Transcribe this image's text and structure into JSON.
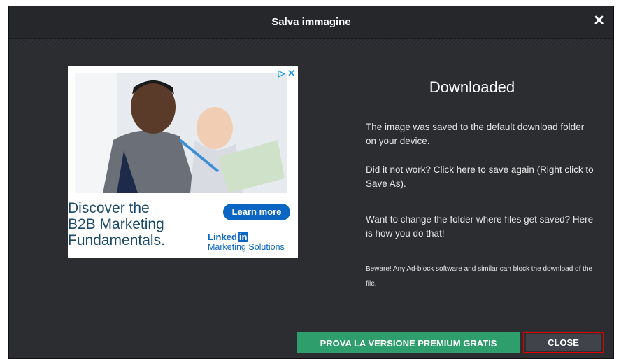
{
  "dialog": {
    "title": "Salva immagine",
    "close_icon": "close-icon",
    "heading": "Downloaded",
    "paragraphs": [
      "The image was saved to the default download folder on your device.",
      "Did it not work? Click here to save again (Right click to Save As).",
      "Want to change the folder where files get saved? Here is how you do that!",
      "Beware! Any Ad-block software and similar can block the download of the file."
    ],
    "premium_button": "PROVA LA VERSIONE PREMIUM GRATIS",
    "close_button": "CLOSE"
  },
  "ad": {
    "badge": "▷ ✕",
    "headline_lines": [
      "Discover the",
      "B2B Marketing",
      "Fundamentals."
    ],
    "cta": "Learn more",
    "brand_linked": "Linked",
    "brand_in": "in",
    "brand_tagline": "Marketing Solutions"
  },
  "colors": {
    "dialog_bg": "#2b2d31",
    "premium_green": "#2e9e6d",
    "highlight_red": "#e00000",
    "linkedin_blue": "#0a66c2"
  }
}
